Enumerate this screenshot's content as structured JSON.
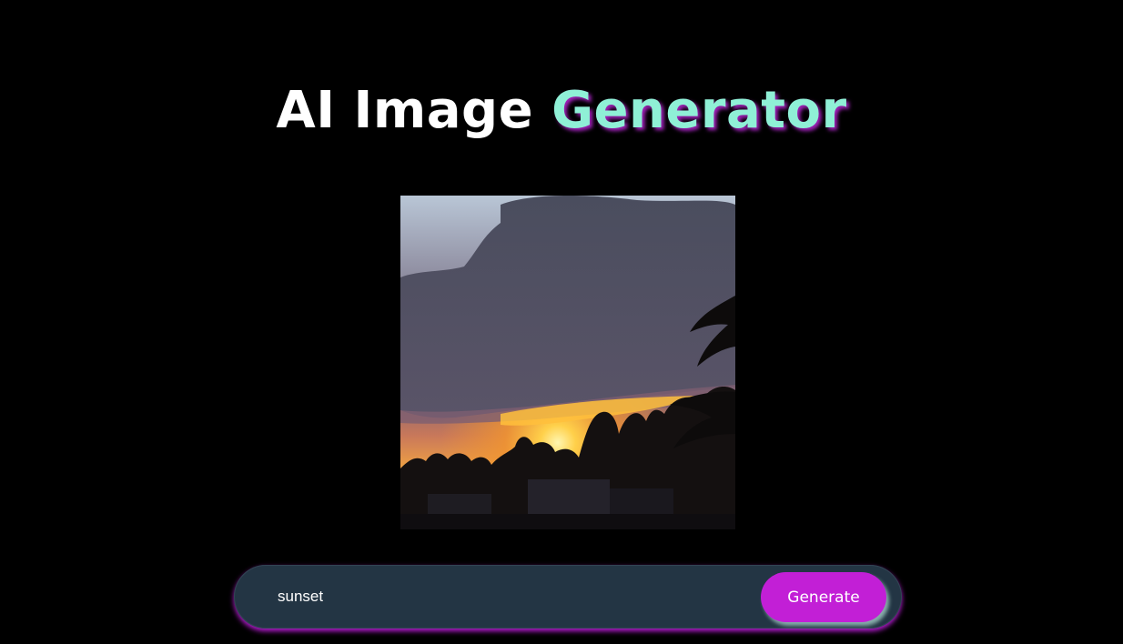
{
  "header": {
    "title_main": "AI Image",
    "title_accent": "Generator"
  },
  "generated_image": {
    "alt": "sunset"
  },
  "prompt": {
    "value": "sunset",
    "generate_label": "Generate"
  },
  "colors": {
    "background": "#000000",
    "accent_text": "#8ff0d6",
    "accent_shadow": "#be28dc",
    "button": "#c21fd6",
    "input_bar": "#233544"
  }
}
